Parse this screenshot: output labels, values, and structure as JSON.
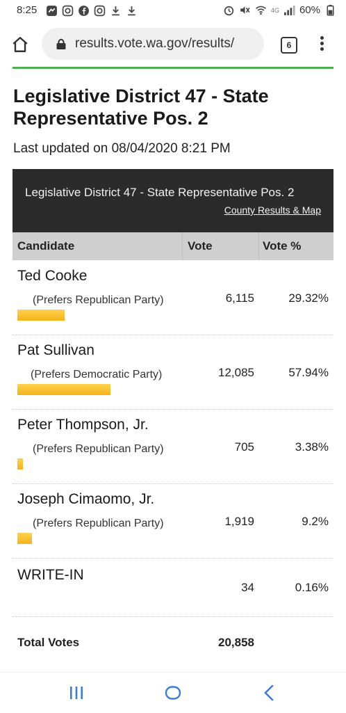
{
  "status_bar": {
    "time": "8:25",
    "network_label": "4G",
    "battery": "60%",
    "left_icons": [
      "messenger-icon",
      "instagram-icon",
      "facebook-icon",
      "instagram-icon",
      "download-icon",
      "download-icon"
    ],
    "right_icons": [
      "alarm-icon",
      "mute-icon",
      "wifi-icon",
      "signal-icon",
      "battery-icon"
    ]
  },
  "browser": {
    "url": "results.vote.wa.gov/results/",
    "tab_count": "6"
  },
  "page": {
    "title": "Legislative District 47 - State Representative Pos. 2",
    "last_updated": "Last updated on 08/04/2020 8:21 PM",
    "results_header_title": "Legislative District 47 - State Representative Pos. 2",
    "county_link": "County Results & Map"
  },
  "table": {
    "columns": [
      "Candidate",
      "Vote",
      "Vote %"
    ],
    "bar_color": "#f6b21a",
    "rows": [
      {
        "name": "Ted Cooke",
        "party": "(Prefers Republican Party)",
        "votes": "6,115",
        "percent": "29.32%",
        "share": 0.2932
      },
      {
        "name": "Pat Sullivan",
        "party": "(Prefers Democratic Party)",
        "votes": "12,085",
        "percent": "57.94%",
        "share": 0.5794
      },
      {
        "name": "Peter Thompson, Jr.",
        "party": "(Prefers Republican Party)",
        "votes": "705",
        "percent": "3.38%",
        "share": 0.0338
      },
      {
        "name": "Joseph Cimaomo, Jr.",
        "party": "(Prefers Republican Party)",
        "votes": "1,919",
        "percent": "9.2%",
        "share": 0.092
      },
      {
        "name": "WRITE-IN",
        "party": "",
        "votes": "34",
        "percent": "0.16%",
        "share": 0.0016
      }
    ],
    "total_label": "Total Votes",
    "total_votes": "20,858"
  }
}
